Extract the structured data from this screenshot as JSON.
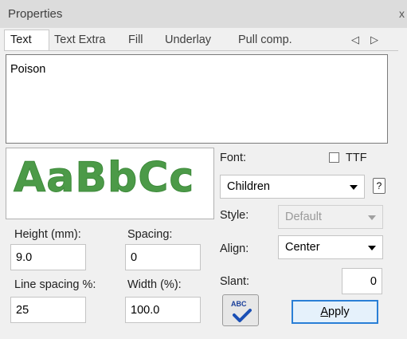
{
  "panel": {
    "title": "Properties",
    "close": "x"
  },
  "tabs": [
    {
      "label": "Text",
      "active": true
    },
    {
      "label": "Text Extra"
    },
    {
      "label": "Fill"
    },
    {
      "label": "Underlay"
    },
    {
      "label": "Pull comp."
    }
  ],
  "tab_nav": {
    "prev": "◁",
    "next": "▷"
  },
  "text_content": "Poison",
  "preview": {
    "sample": "AaBbCc",
    "color": "#4c9a48"
  },
  "font": {
    "label": "Font:",
    "value": "Children",
    "ttf_label": "TTF",
    "ttf_checked": false,
    "help": "?"
  },
  "style": {
    "label": "Style:",
    "value": "Default",
    "enabled": false
  },
  "align": {
    "label": "Align:",
    "value": "Center"
  },
  "slant": {
    "label": "Slant:",
    "value": "0"
  },
  "height": {
    "label": "Height (mm):",
    "value": "9.0"
  },
  "spacing": {
    "label": "Spacing:",
    "value": "0"
  },
  "line_spacing": {
    "label": "Line spacing %:",
    "value": "25"
  },
  "width": {
    "label": "Width (%):",
    "value": "100.0"
  },
  "spellcheck": {
    "icon_text": "ABC"
  },
  "apply": {
    "label_first": "A",
    "label_rest": "pply"
  }
}
